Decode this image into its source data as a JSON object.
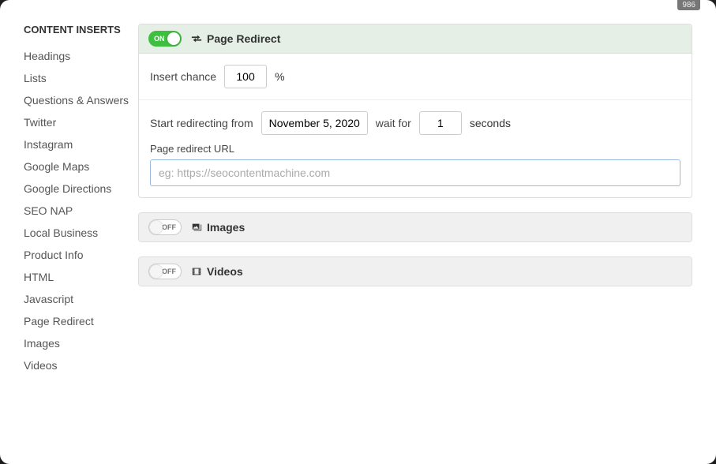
{
  "badge": "986",
  "sidebar": {
    "title": "CONTENT INSERTS",
    "items": [
      "Headings",
      "Lists",
      "Questions & Answers",
      "Twitter",
      "Instagram",
      "Google Maps",
      "Google Directions",
      "SEO NAP",
      "Local Business",
      "Product Info",
      "HTML",
      "Javascript",
      "Page Redirect",
      "Images",
      "Videos"
    ]
  },
  "toggle": {
    "on": "ON",
    "off": "OFF"
  },
  "pageRedirect": {
    "title": "Page Redirect",
    "insertChanceLabel": "Insert chance",
    "insertChanceValue": "100",
    "percent": "%",
    "startLabel": "Start redirecting from",
    "startDate": "November 5, 2020",
    "waitLabel": "wait for",
    "waitValue": "1",
    "secondsLabel": "seconds",
    "urlLabel": "Page redirect URL",
    "urlPlaceholder": "eg: https://seocontentmachine.com"
  },
  "images": {
    "title": "Images"
  },
  "videos": {
    "title": "Videos"
  }
}
